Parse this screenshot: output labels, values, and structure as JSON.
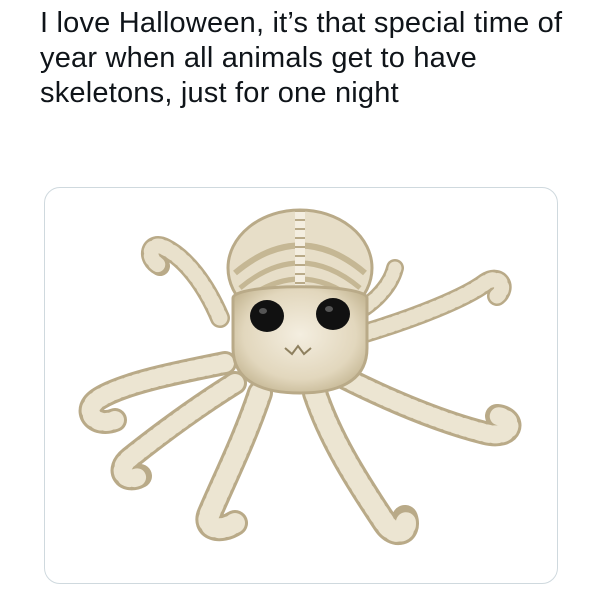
{
  "tweet": {
    "text": "I love Halloween, it’s that special time of year when all animals get to have skeletons, just for one night"
  },
  "media": {
    "subject": "octopus skeleton decoration",
    "colors": {
      "bone_light": "#efe8d6",
      "bone_mid": "#ddd2b8",
      "bone_shadow": "#b9aa88",
      "eye": "#111111",
      "card_border": "#cfd9de"
    }
  }
}
